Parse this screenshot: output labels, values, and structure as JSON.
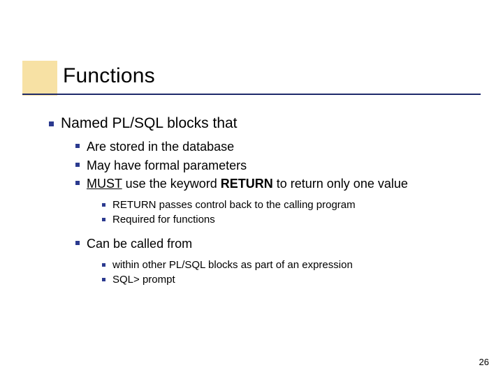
{
  "title": "Functions",
  "lvl1": {
    "a": "Named PL/SQL blocks that"
  },
  "lvl2": {
    "a": "Are stored in the database",
    "b": "May have formal parameters",
    "c_pre": "MUST",
    "c_mid": " use the keyword ",
    "c_bold": "RETURN",
    "c_post": " to return only one value",
    "d": "Can be called from"
  },
  "lvl3": {
    "a": "RETURN passes control back to the calling program",
    "b": "Required for functions",
    "c": "within other PL/SQL blocks as part of an expression",
    "d": "SQL> prompt"
  },
  "page": "26"
}
